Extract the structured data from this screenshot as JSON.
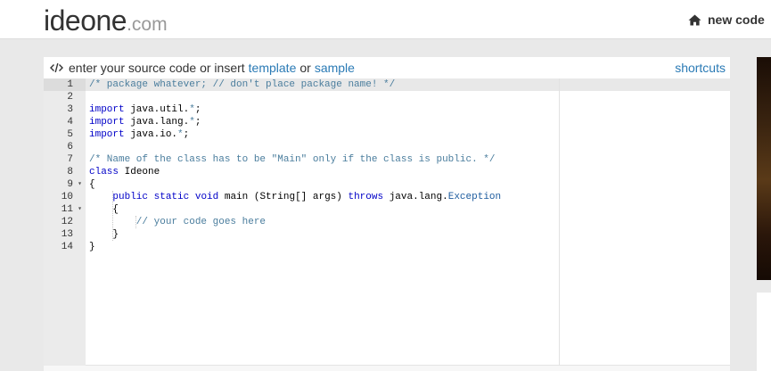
{
  "header": {
    "logo_main": "ideone",
    "logo_ext": ".com",
    "new_code_label": "new code",
    "new_code_icon": "home-icon"
  },
  "editor_panel": {
    "header_icon": "code-icon",
    "header_text": "enter your source code or insert",
    "template_link": "template",
    "or_text": "or",
    "sample_link": "sample",
    "shortcuts_link": "shortcuts"
  },
  "code": {
    "lines": [
      {
        "num": "1",
        "fold": "",
        "text": "/* package whatever; // don't place package name! */"
      },
      {
        "num": "2",
        "fold": "",
        "text": ""
      },
      {
        "num": "3",
        "fold": "",
        "text": "import java.util.*;"
      },
      {
        "num": "4",
        "fold": "",
        "text": "import java.lang.*;"
      },
      {
        "num": "5",
        "fold": "",
        "text": "import java.io.*;"
      },
      {
        "num": "6",
        "fold": "",
        "text": ""
      },
      {
        "num": "7",
        "fold": "",
        "text": "/* Name of the class has to be \"Main\" only if the class is public. */"
      },
      {
        "num": "8",
        "fold": "",
        "text": "class Ideone"
      },
      {
        "num": "9",
        "fold": "▾",
        "text": "{"
      },
      {
        "num": "10",
        "fold": "",
        "text": "    public static void main (String[] args) throws java.lang.Exception"
      },
      {
        "num": "11",
        "fold": "▾",
        "text": "    {"
      },
      {
        "num": "12",
        "fold": "",
        "text": "        // your code goes here"
      },
      {
        "num": "13",
        "fold": "",
        "text": "    }"
      },
      {
        "num": "14",
        "fold": "",
        "text": "}"
      }
    ],
    "active_line": 1
  },
  "colors": {
    "link": "#2a7ab5",
    "comment": "#4a7d9d",
    "keyword": "#0000c8",
    "gutter": "#ebebeb"
  }
}
